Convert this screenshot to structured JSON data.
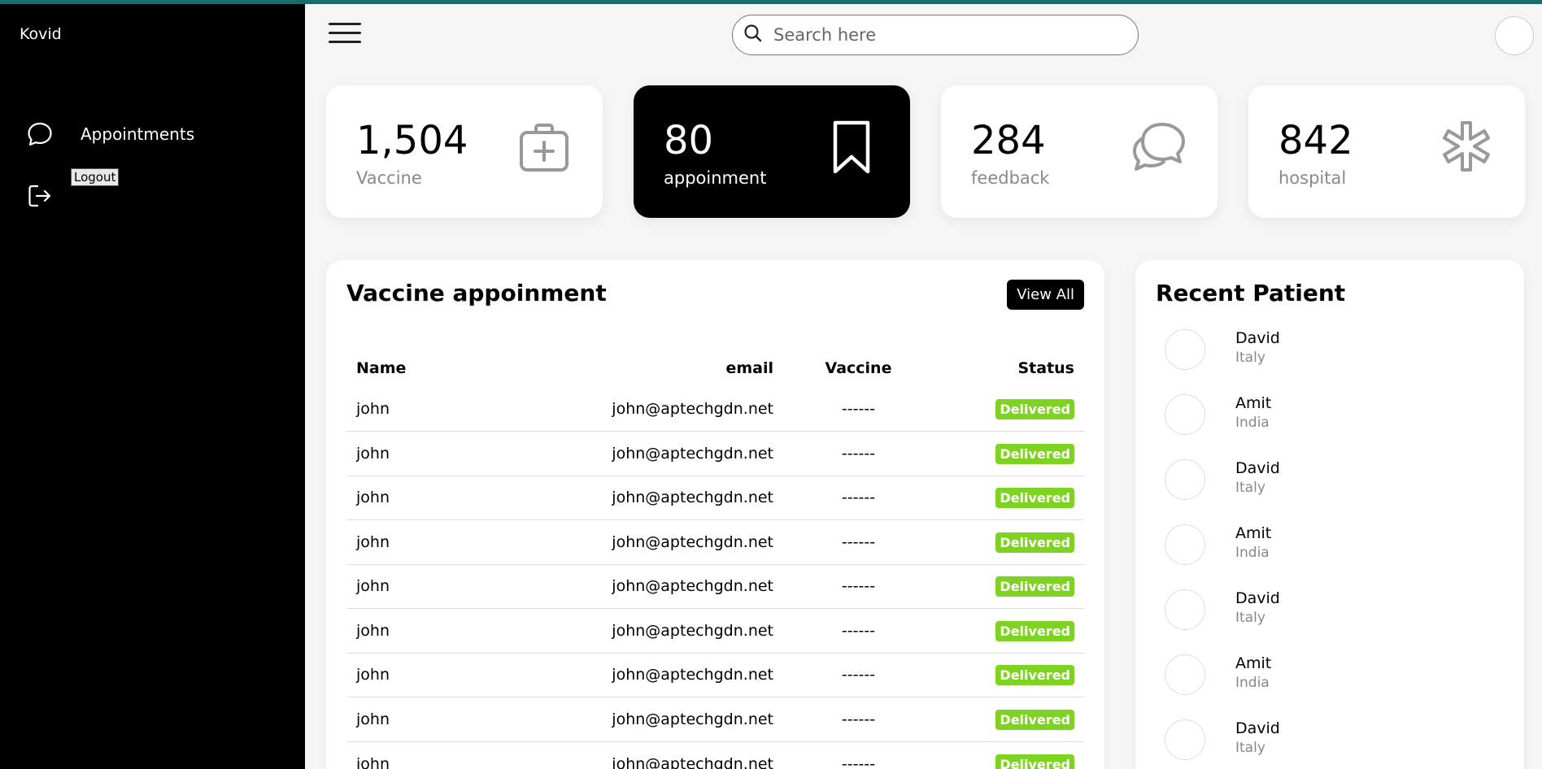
{
  "sidebar": {
    "brand": "Kovid",
    "items": [
      {
        "label": "Appointments",
        "icon": "chat-bubble-icon"
      },
      {
        "label": "",
        "icon": "logout-icon"
      }
    ],
    "tooltip": "Logout"
  },
  "topbar": {
    "search_placeholder": "Search here"
  },
  "stats": [
    {
      "value": "1,504",
      "label": "Vaccine",
      "icon": "medical-kit-icon"
    },
    {
      "value": "80",
      "label": "appoinment",
      "icon": "bookmark-icon",
      "active": true
    },
    {
      "value": "284",
      "label": "feedback",
      "icon": "chat-bubbles-icon"
    },
    {
      "value": "842",
      "label": "hospital",
      "icon": "asterisk-icon"
    }
  ],
  "appointments": {
    "title": "Vaccine appoinment",
    "view_all": "View All",
    "columns": [
      "Name",
      "email",
      "Vaccine",
      "Status"
    ],
    "rows": [
      [
        "john",
        "john@aptechgdn.net",
        "------",
        "Delivered"
      ],
      [
        "john",
        "john@aptechgdn.net",
        "------",
        "Delivered"
      ],
      [
        "john",
        "john@aptechgdn.net",
        "------",
        "Delivered"
      ],
      [
        "john",
        "john@aptechgdn.net",
        "------",
        "Delivered"
      ],
      [
        "john",
        "john@aptechgdn.net",
        "------",
        "Delivered"
      ],
      [
        "john",
        "john@aptechgdn.net",
        "------",
        "Delivered"
      ],
      [
        "john",
        "john@aptechgdn.net",
        "------",
        "Delivered"
      ],
      [
        "john",
        "john@aptechgdn.net",
        "------",
        "Delivered"
      ],
      [
        "john",
        "john@aptechgdn.net",
        "------",
        "Delivered"
      ]
    ]
  },
  "recent": {
    "title": "Recent Patient",
    "patients": [
      {
        "name": "David",
        "country": "Italy"
      },
      {
        "name": "Amit",
        "country": "India"
      },
      {
        "name": "David",
        "country": "Italy"
      },
      {
        "name": "Amit",
        "country": "India"
      },
      {
        "name": "David",
        "country": "Italy"
      },
      {
        "name": "Amit",
        "country": "India"
      },
      {
        "name": "David",
        "country": "Italy"
      }
    ]
  },
  "colors": {
    "sidebar_bg": "#000000",
    "accent_top": "#1a6b6b",
    "status_delivered": "#7ed321"
  }
}
